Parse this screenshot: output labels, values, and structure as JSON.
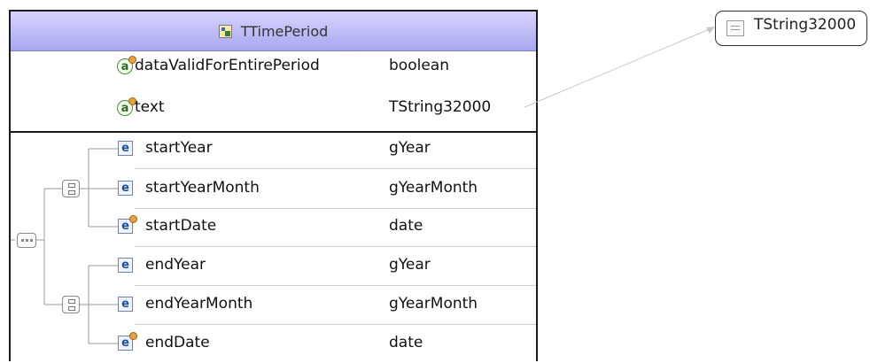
{
  "complex_type": {
    "name": "TTimePeriod",
    "icon": "complex-type-icon"
  },
  "attributes": [
    {
      "name": "dataValidForEntirePeriod",
      "type": "boolean",
      "icon": "attribute-icon"
    },
    {
      "name": "text",
      "type": "TString32000",
      "icon": "attribute-icon"
    }
  ],
  "content_model": {
    "sequence_icon": "sequence-icon",
    "choice_icon": "choice-icon",
    "choices": [
      {
        "elements": [
          {
            "name": "startYear",
            "type": "gYear",
            "optional": false
          },
          {
            "name": "startYearMonth",
            "type": "gYearMonth",
            "optional": false
          },
          {
            "name": "startDate",
            "type": "date",
            "optional": true
          }
        ]
      },
      {
        "elements": [
          {
            "name": "endYear",
            "type": "gYear",
            "optional": false
          },
          {
            "name": "endYearMonth",
            "type": "gYearMonth",
            "optional": false
          },
          {
            "name": "endDate",
            "type": "date",
            "optional": true
          }
        ]
      }
    ]
  },
  "referenced_type": {
    "name": "TString32000",
    "icon": "simple-type-icon"
  },
  "colors": {
    "header_top": "#d7d5ff",
    "header_bottom": "#a9a6f0",
    "border": "#1a1a1a"
  }
}
